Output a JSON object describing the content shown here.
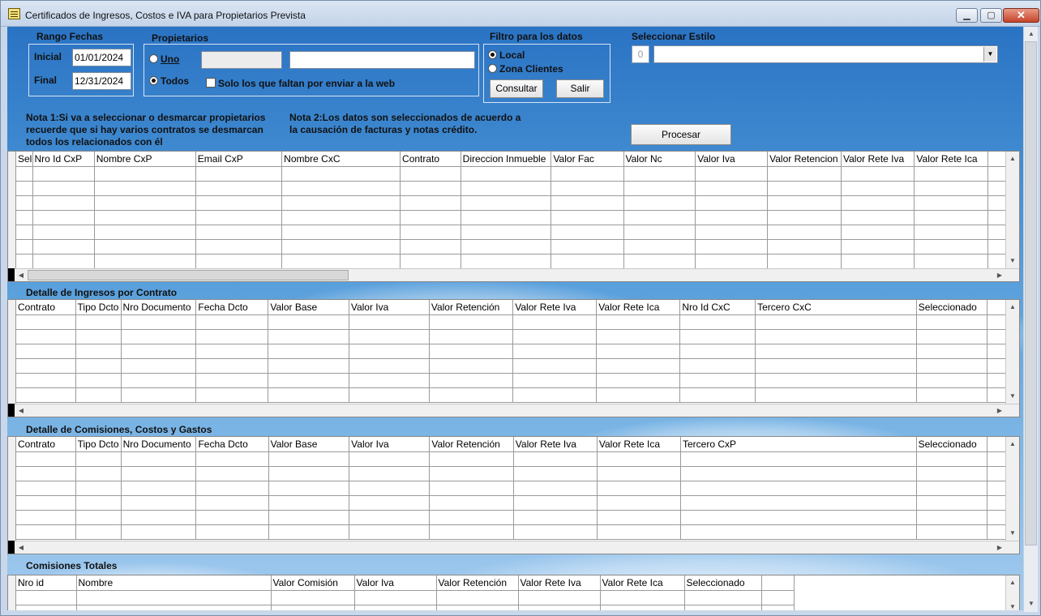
{
  "window": {
    "title": "Certificados de Ingresos, Costos e IVA para Propietarios Prevista"
  },
  "rango": {
    "label": "Rango Fechas",
    "inicial_label": "Inicial",
    "inicial_value": "01/01/2024",
    "final_label": "Final",
    "final_value": "12/31/2024"
  },
  "propietarios": {
    "label": "Propietarios",
    "uno_label": "Uno",
    "todos_label": "Todos",
    "selected": "Todos",
    "solo_label": "Solo los que faltan  por enviar a la web"
  },
  "filtro": {
    "label": "Filtro para los datos",
    "local_label": "Local",
    "zona_label": "Zona Clientes",
    "selected": "Local",
    "consultar_label": "Consultar",
    "salir_label": "Salir"
  },
  "estilo": {
    "label": "Seleccionar Estilo",
    "index": "0",
    "value": ""
  },
  "notes": {
    "nota1": [
      "Nota 1:Si va a seleccionar o desmarcar propietarios",
      "recuerde que si hay varios contratos se desmarcan",
      "todos los relacionados con él"
    ],
    "nota2": [
      "Nota 2:Los datos son seleccionados de acuerdo a",
      "la causación de facturas y notas crédito."
    ]
  },
  "procesar_label": "Procesar",
  "grid1": {
    "columns": [
      "Sele",
      "Nro Id CxP",
      "Nombre CxP",
      "Email CxP",
      "Nombre CxC",
      "Contrato",
      "Direccion Inmueble",
      "Valor Fac",
      "Valor Nc",
      "Valor Iva",
      "Valor Retencion",
      "Valor Rete Iva",
      "Valor Rete Ica"
    ]
  },
  "section2": {
    "title": "Detalle de Ingresos por Contrato",
    "columns": [
      "Contrato",
      "Tipo Dcto",
      "Nro Documento",
      "Fecha Dcto",
      "Valor Base",
      "Valor Iva",
      "Valor Retención",
      "Valor Rete Iva",
      "Valor Rete Ica",
      "Nro Id CxC",
      "Tercero CxC",
      "Seleccionado"
    ]
  },
  "section3": {
    "title": "Detalle de Comisiones, Costos y Gastos",
    "columns": [
      "Contrato",
      "Tipo Dcto",
      "Nro Documento",
      "Fecha Dcto",
      "Valor Base",
      "Valor Iva",
      "Valor Retención",
      "Valor Rete Iva",
      "Valor Rete Ica",
      "Tercero CxP",
      "Seleccionado"
    ]
  },
  "section4": {
    "title": "Comisiones Totales",
    "columns": [
      "Nro id",
      "Nombre",
      "Valor Comisión",
      "Valor Iva",
      "Valor Retención",
      "Valor Rete Iva",
      "Valor Rete Ica",
      "Seleccionado"
    ]
  }
}
